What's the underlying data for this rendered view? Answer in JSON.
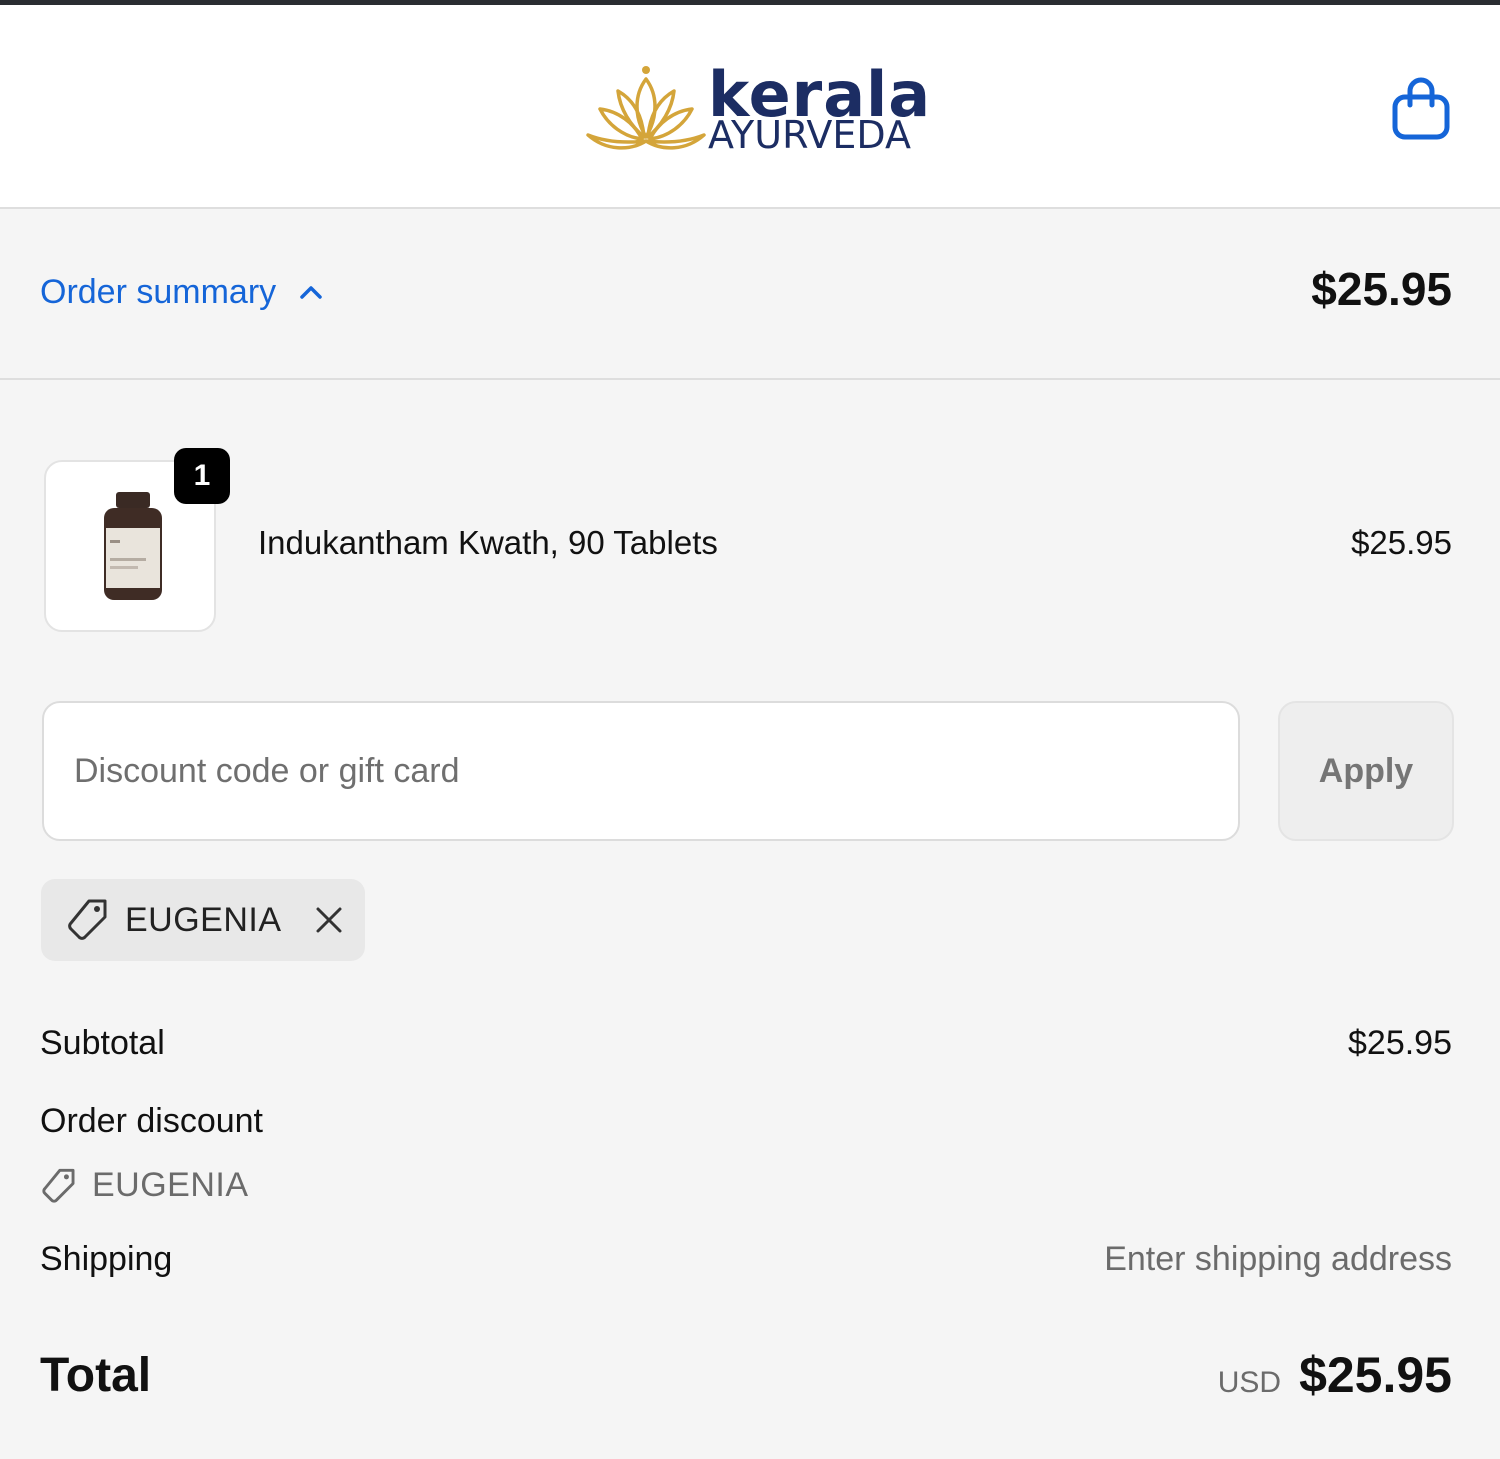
{
  "header": {
    "logo_main": "kerala",
    "logo_sub": "AYURVEDA",
    "cart_icon": "shopping-bag-icon"
  },
  "summary": {
    "toggle_label": "Order summary",
    "toggle_icon": "chevron-up-icon",
    "total": "$25.95",
    "accent_color": "#1565d8"
  },
  "product": {
    "quantity": "1",
    "name": "Indukantham Kwath, 90 Tablets",
    "price": "$25.95",
    "image_icon": "product-bottle-image"
  },
  "discount": {
    "placeholder": "Discount code or gift card",
    "apply_label": "Apply",
    "applied_code": "EUGENIA"
  },
  "totals": {
    "subtotal_label": "Subtotal",
    "subtotal_value": "$25.95",
    "order_discount_label": "Order discount",
    "order_discount_code": "EUGENIA",
    "shipping_label": "Shipping",
    "shipping_value": "Enter shipping address",
    "total_label": "Total",
    "currency": "USD",
    "total_value": "$25.95"
  }
}
